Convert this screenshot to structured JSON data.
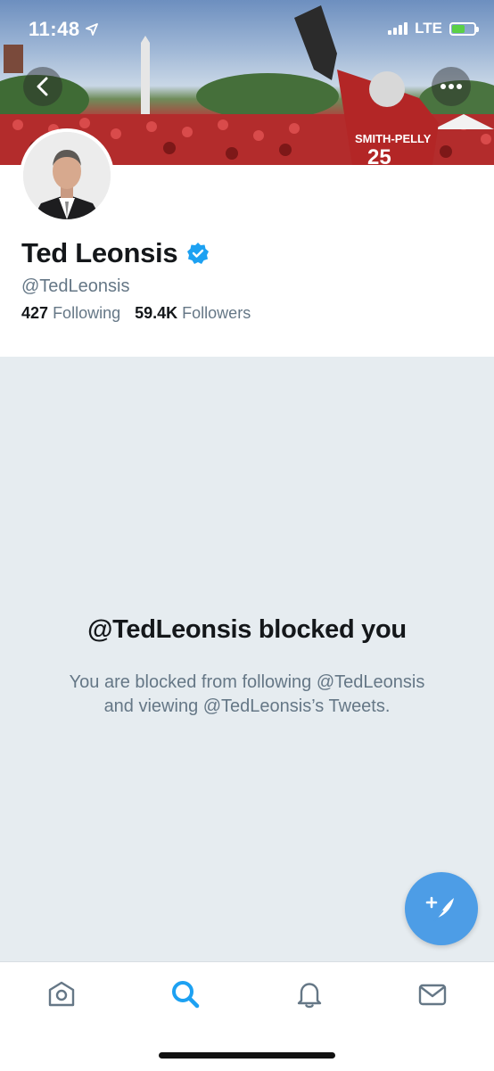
{
  "status_bar": {
    "time": "11:48",
    "network": "LTE",
    "battery_level": 0.55,
    "battery_color": "#5ad046"
  },
  "header": {
    "back_icon": "chevron-left-icon",
    "more_icon": "ellipsis-icon",
    "banner_jersey_text": "SMITH-PELLY",
    "banner_jersey_number": "25"
  },
  "profile": {
    "name": "Ted Leonsis",
    "verified": true,
    "verified_color": "#1da1f2",
    "handle": "@TedLeonsis",
    "following_count": "427",
    "following_label": "Following",
    "followers_count": "59.4K",
    "followers_label": "Followers"
  },
  "blocked": {
    "title": "@TedLeonsis blocked you",
    "line1": "You are blocked from following @TedLeonsis",
    "line2": "and viewing @TedLeonsis’s Tweets."
  },
  "compose": {
    "icon": "compose-quill-icon",
    "color": "#4d9de6"
  },
  "tab_bar": {
    "tabs": [
      {
        "name": "home",
        "icon": "home-icon",
        "active": false
      },
      {
        "name": "search",
        "icon": "search-icon",
        "active": true
      },
      {
        "name": "notifications",
        "icon": "bell-icon",
        "active": false
      },
      {
        "name": "messages",
        "icon": "mail-icon",
        "active": false
      }
    ],
    "active_color": "#1da1f2",
    "inactive_color": "#657786"
  }
}
